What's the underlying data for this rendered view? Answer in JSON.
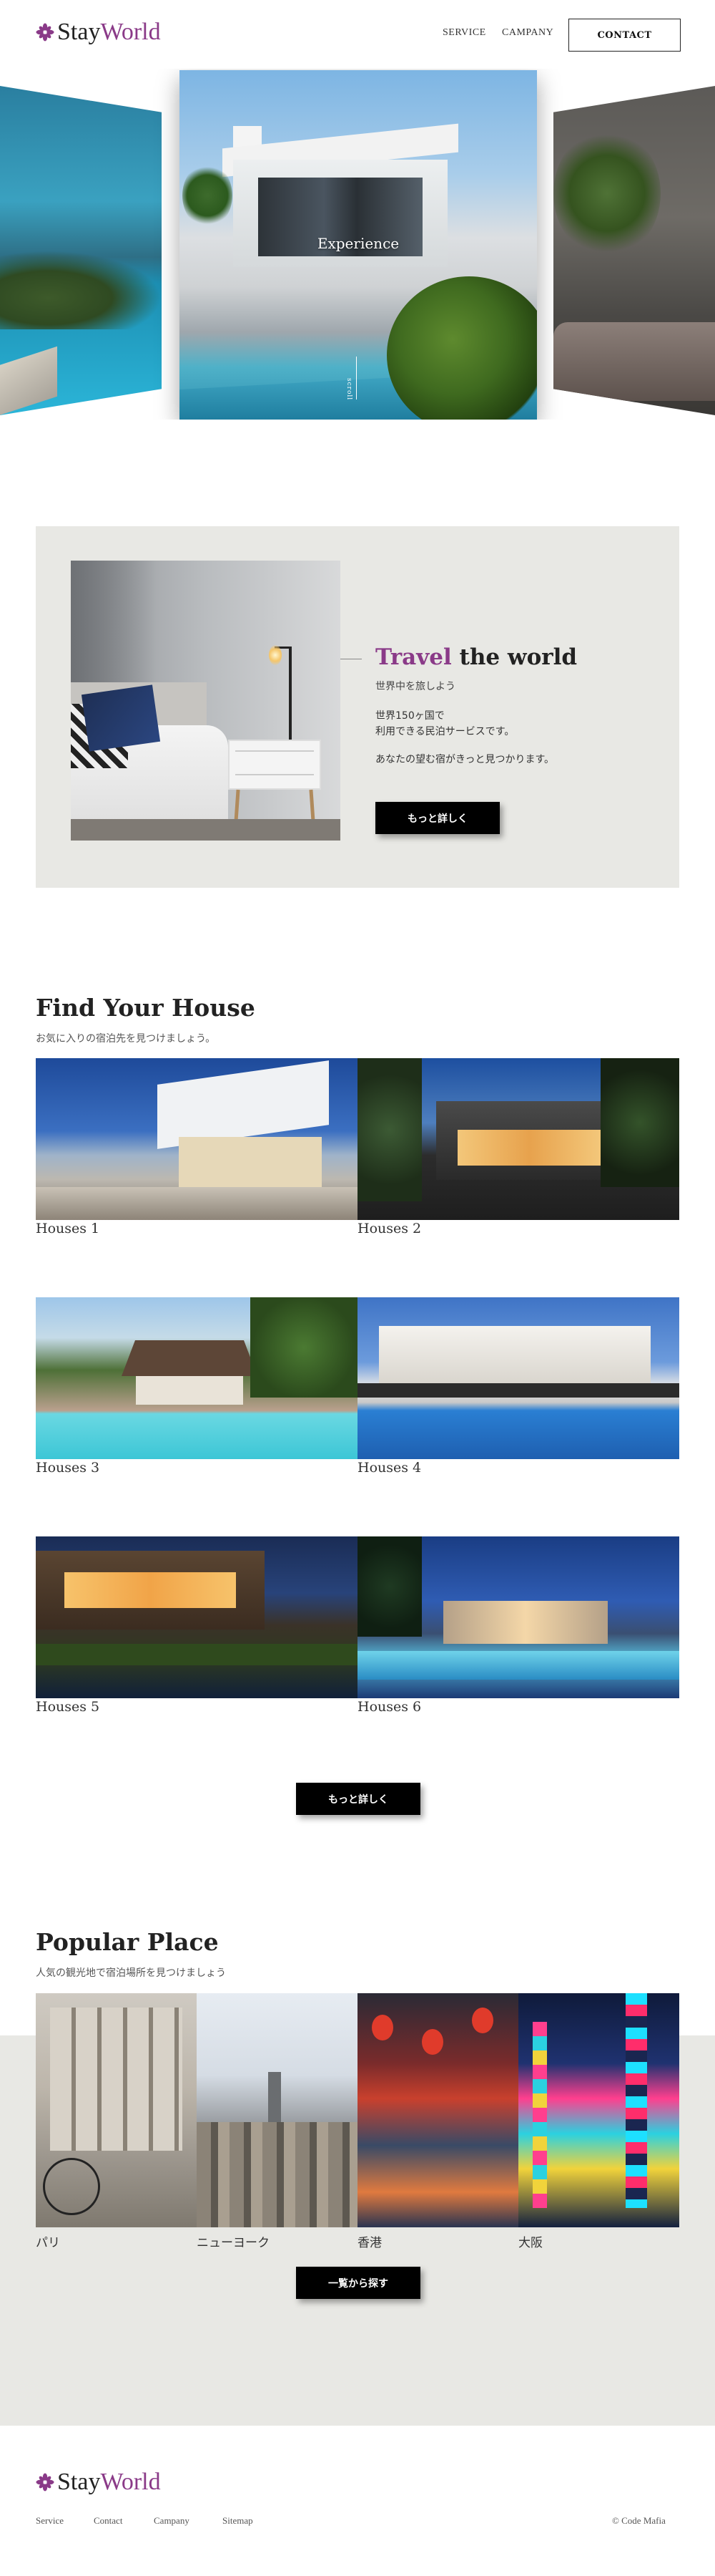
{
  "brand": {
    "name_part1": "Stay",
    "name_part2": "World",
    "accent_color": "#8a3a88"
  },
  "nav": {
    "service": "SERVICE",
    "company": "CAMPANY",
    "contact": "CONTACT"
  },
  "hero": {
    "center_label": "Experience",
    "vertical_text": "scroll"
  },
  "travel": {
    "title_accent": "Travel",
    "title_rest": " the world",
    "subtitle": "世界中を旅しよう",
    "desc_line1": "世界150ヶ国で",
    "desc_line2": "利用できる民泊サービスです。",
    "desc_line3": "あなたの望む宿がきっと見つかります。",
    "button": "もっと詳しく"
  },
  "houses": {
    "title": "Find Your House",
    "subtitle": "お気に入りの宿泊先を見つけましょう。",
    "items": [
      "Houses 1",
      "Houses 2",
      "Houses 3",
      "Houses 4",
      "Houses 5",
      "Houses 6"
    ],
    "button": "もっと詳しく"
  },
  "popular": {
    "title": "Popular Place",
    "subtitle": "人気の観光地で宿泊場所を見つけましょう",
    "places": [
      "パリ",
      "ニューヨーク",
      "香港",
      "大阪"
    ],
    "button": "一覧から探す"
  },
  "footer": {
    "links": [
      "Service",
      "Contact",
      "Campany",
      "Sitemap"
    ],
    "copyright": "© Code Mafia"
  }
}
